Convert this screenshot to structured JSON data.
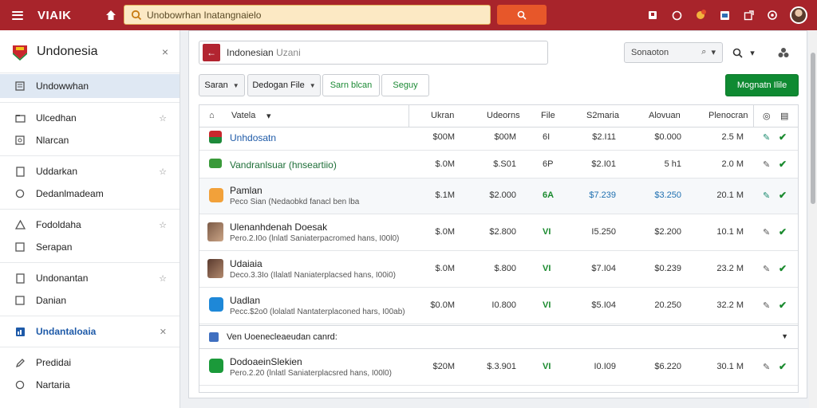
{
  "app": {
    "brand": "VIAIK",
    "search_value": "Unobowrhan Inatangnaielo",
    "colors": {
      "topbar": "#a8242b",
      "accent_green": "#0f8a32",
      "search_button": "#e7572a"
    }
  },
  "sidebar": {
    "title": "Undonesia",
    "close": "×",
    "items": [
      {
        "label": "Undowwhan",
        "icon": "document-icon",
        "active": true
      },
      {
        "label": "Ulcedhan",
        "icon": "folder-icon",
        "pinned": true
      },
      {
        "label": "Nlarcan",
        "icon": "grid-icon"
      },
      {
        "label": "Uddarkan",
        "icon": "file-icon",
        "pinned": true
      },
      {
        "label": "Dedanlmadeam",
        "icon": "circle-icon"
      },
      {
        "label": "Fodoldaha",
        "icon": "warning-icon",
        "pinned": true
      },
      {
        "label": "Serapan",
        "icon": "box-icon"
      },
      {
        "label": "Undonantan",
        "icon": "file-icon",
        "pinned": true
      },
      {
        "label": "Danian",
        "icon": "box-icon"
      },
      {
        "label": "Undantaloaia",
        "icon": "chart-icon",
        "pinned": true,
        "strong": true
      },
      {
        "label": "Predidai",
        "icon": "pen-icon"
      },
      {
        "label": "Nartaria",
        "icon": "circle-icon"
      }
    ]
  },
  "path": {
    "name": "Indonesian",
    "sub": "Uzani"
  },
  "filter": {
    "label": "Sonaoton"
  },
  "toolbar": {
    "saran": "Saran",
    "dedogan": "Dedogan File",
    "sarn": "Sarn blcan",
    "seguy": "Seguy",
    "primary": "Mognatn Ilile"
  },
  "table": {
    "headers": [
      "Vatela",
      "Ukran",
      "Udeorns",
      "File",
      "S2maria",
      "Alovuan",
      "Plenocran"
    ],
    "rows": [
      {
        "name": "Unhdosatn",
        "sub": "",
        "ukran": "$00M",
        "udeorns": "$00M",
        "file": "6I",
        "s2": "$2.I11",
        "alov": "$0.000",
        "plen": "2.5 M",
        "thumb": "flag"
      },
      {
        "name": "Vandranlsuar (hnseartiio)",
        "sub": "",
        "ukran": "$.0M",
        "udeorns": "$.S01",
        "file": "6P",
        "s2": "$2.I01",
        "alov": "5 h1",
        "plen": "2.0 M",
        "thumb": "green-card"
      },
      {
        "name": "Pamlan",
        "sub": "Peco Sian (Nedaobkd fanacl ben lba",
        "ukran": "$.1M",
        "udeorns": "$2.000",
        "file": "6A",
        "s2": "$7.239",
        "alov": "$3.250",
        "plen": "20.1 M",
        "thumb": "orange"
      },
      {
        "name": "Ulenanhdenah Doesak",
        "sub": "Pero.2.I0o (lnlatl Saniaterpacromed hans, I00l0)",
        "ukran": "$.0M",
        "udeorns": "$2.800",
        "file": "VI",
        "s2": "I5.250",
        "alov": "$2.200",
        "plen": "10.1 M",
        "thumb": "photo"
      },
      {
        "name": "Udaiaia",
        "sub": "Deco.3.3Io (Ilalatl Naniaterplacsed hans, I00i0)",
        "ukran": "$.0M",
        "udeorns": "$.800",
        "file": "VI",
        "s2": "$7.I04",
        "alov": "$0.239",
        "plen": "23.2 M",
        "thumb": "photo2"
      },
      {
        "name": "Uadlan",
        "sub": "Pecc.$2o0 (lolalatl Nantaterplaconed hars, I00ab)",
        "ukran": "$0.0M",
        "udeorns": "I0.800",
        "file": "VI",
        "s2": "$5.I04",
        "alov": "20.250",
        "plen": "32.2 M",
        "thumb": "blue"
      }
    ],
    "group_label": "Ven Uoenecleaeudan canrd:",
    "last_row": {
      "name": "DodoaeinSlekien",
      "sub": "Pero.2.20 (lnlatl Saniaterplacsred hans, I00l0)",
      "ukran": "$20M",
      "udeorns": "$.3.901",
      "file": "VI",
      "s2": "I0.I09",
      "alov": "$6.220",
      "plen": "30.1 M",
      "thumb": "green"
    }
  }
}
